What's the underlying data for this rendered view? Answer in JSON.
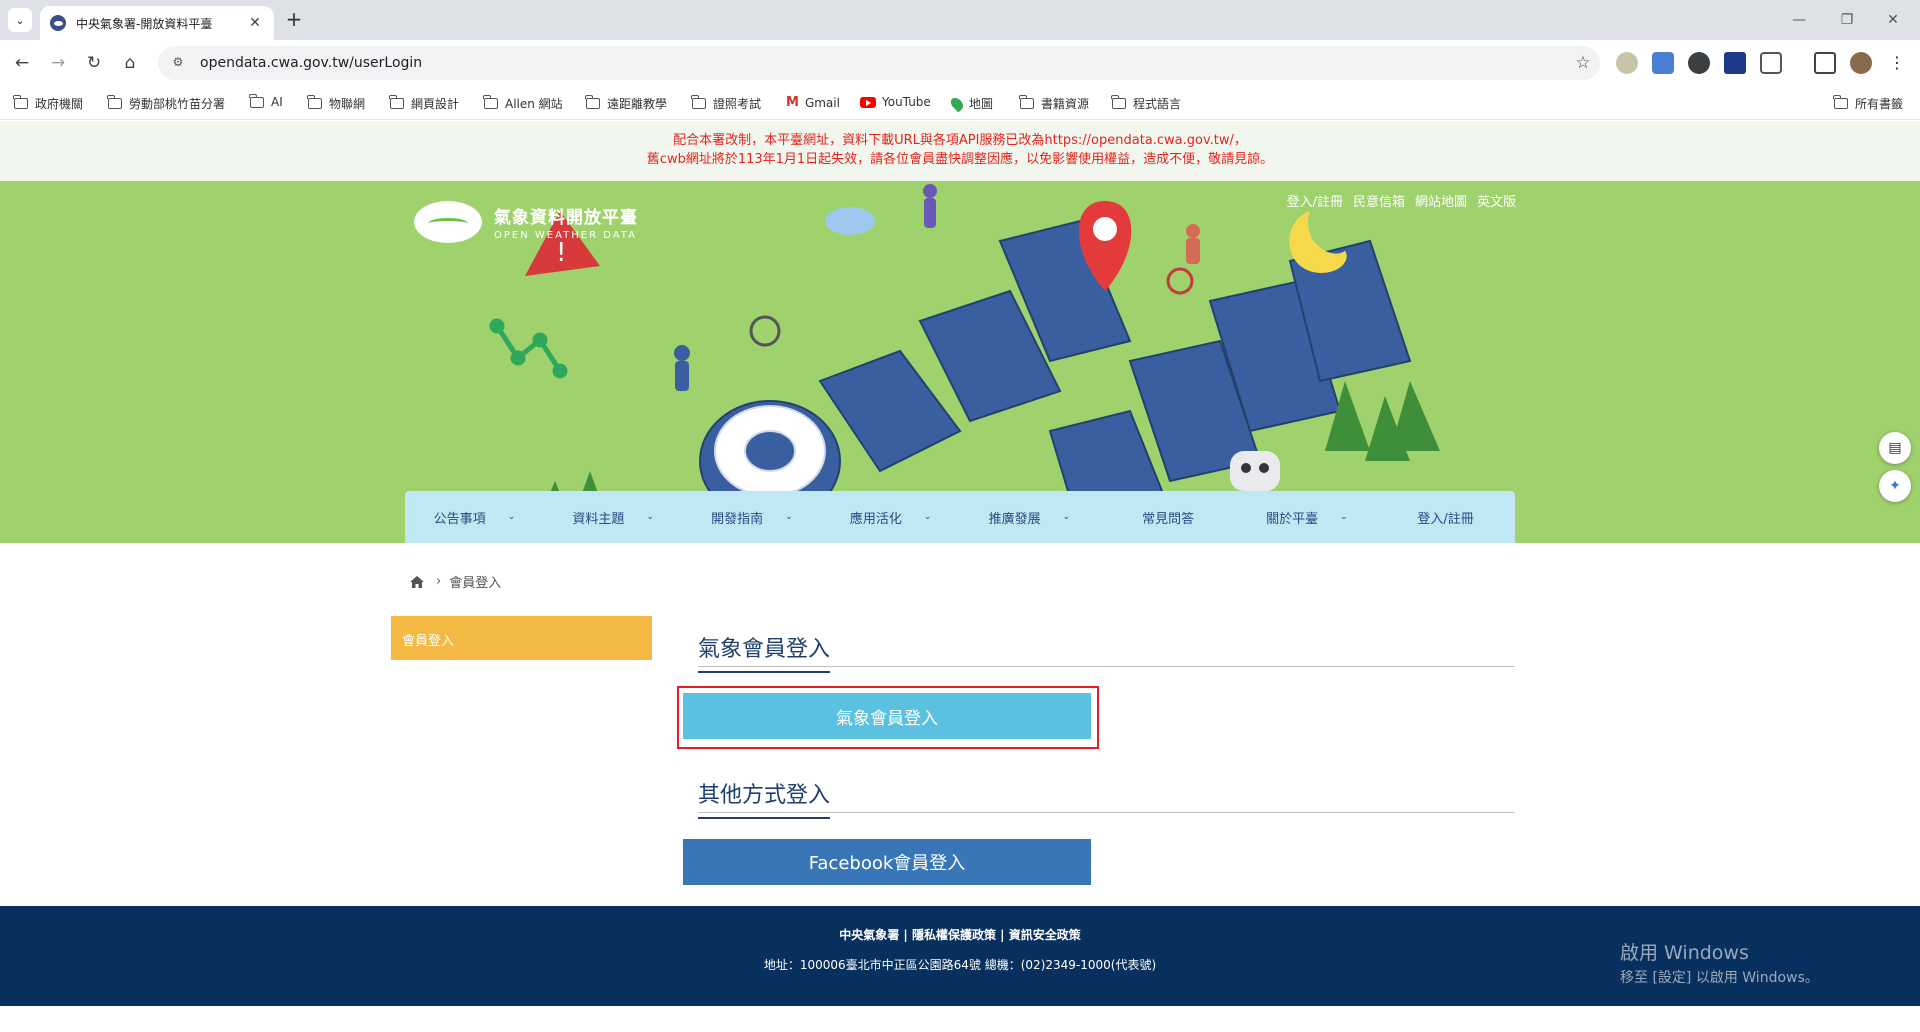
{
  "browser": {
    "tab_title": "中央氣象署-開放資料平臺",
    "url": "opendata.cwa.gov.tw/userLogin",
    "bookmarks": [
      {
        "label": "政府機關",
        "icon": "folder-icon"
      },
      {
        "label": "勞動部桃竹苗分署",
        "icon": "folder-icon"
      },
      {
        "label": "AI",
        "icon": "folder-icon"
      },
      {
        "label": "物聯網",
        "icon": "folder-icon"
      },
      {
        "label": "網頁設計",
        "icon": "folder-icon"
      },
      {
        "label": "Allen 網站",
        "icon": "folder-icon"
      },
      {
        "label": "遠距離教學",
        "icon": "folder-icon"
      },
      {
        "label": "證照考試",
        "icon": "folder-icon"
      },
      {
        "label": "Gmail",
        "icon": "gmail-icon"
      },
      {
        "label": "YouTube",
        "icon": "youtube-icon"
      },
      {
        "label": "地圖",
        "icon": "maps-icon"
      },
      {
        "label": "書籍資源",
        "icon": "folder-icon"
      },
      {
        "label": "程式語言",
        "icon": "folder-icon"
      }
    ],
    "all_bookmarks": "所有書籤"
  },
  "notice": {
    "line1": "配合本署改制，本平臺網址，資料下載URL與各項API服務已改為https://opendata.cwa.gov.tw/，",
    "line2": "舊cwb網址將於113年1月1日起失效，請各位會員盡快調整因應，以免影響使用權益，造成不便，敬請見諒。"
  },
  "site": {
    "name": "氣象資料開放平臺",
    "name_en": "OPEN WEATHER DATA",
    "top_links": [
      "登入/註冊",
      "民意信箱",
      "網站地圖",
      "英文版"
    ],
    "nav": [
      {
        "label": "公告事項",
        "has_menu": true
      },
      {
        "label": "資料主題",
        "has_menu": true
      },
      {
        "label": "開發指南",
        "has_menu": true
      },
      {
        "label": "應用活化",
        "has_menu": true
      },
      {
        "label": "推廣發展",
        "has_menu": true
      },
      {
        "label": "常見問答",
        "has_menu": false
      },
      {
        "label": "關於平臺",
        "has_menu": true
      },
      {
        "label": "登入/註冊",
        "has_menu": false
      }
    ]
  },
  "breadcrumb": {
    "current": "會員登入"
  },
  "sidebar": {
    "active": "會員登入"
  },
  "login": {
    "section1_title": "氣象會員登入",
    "cwa_button": "氣象會員登入",
    "section2_title": "其他方式登入",
    "facebook_button": "Facebook會員登入"
  },
  "footer": {
    "links": "中央氣象署 | 隱私權保護政策 | 資訊安全政策",
    "address": "地址：100006臺北市中正區公園路64號 總機：(02)2349-1000(代表號)"
  },
  "watermark": {
    "line1": "啟用 Windows",
    "line2": "移至 [設定] 以啟用 Windows。"
  },
  "colors": {
    "banner": "#9fd16d",
    "nav": "#bfe7f4",
    "sidebar_active": "#f4b942",
    "cwa_button": "#5bc1e0",
    "facebook_button": "#3876b8",
    "footer": "#07305e",
    "notice_text": "#e8231d",
    "highlight_frame": "#e51e25"
  }
}
